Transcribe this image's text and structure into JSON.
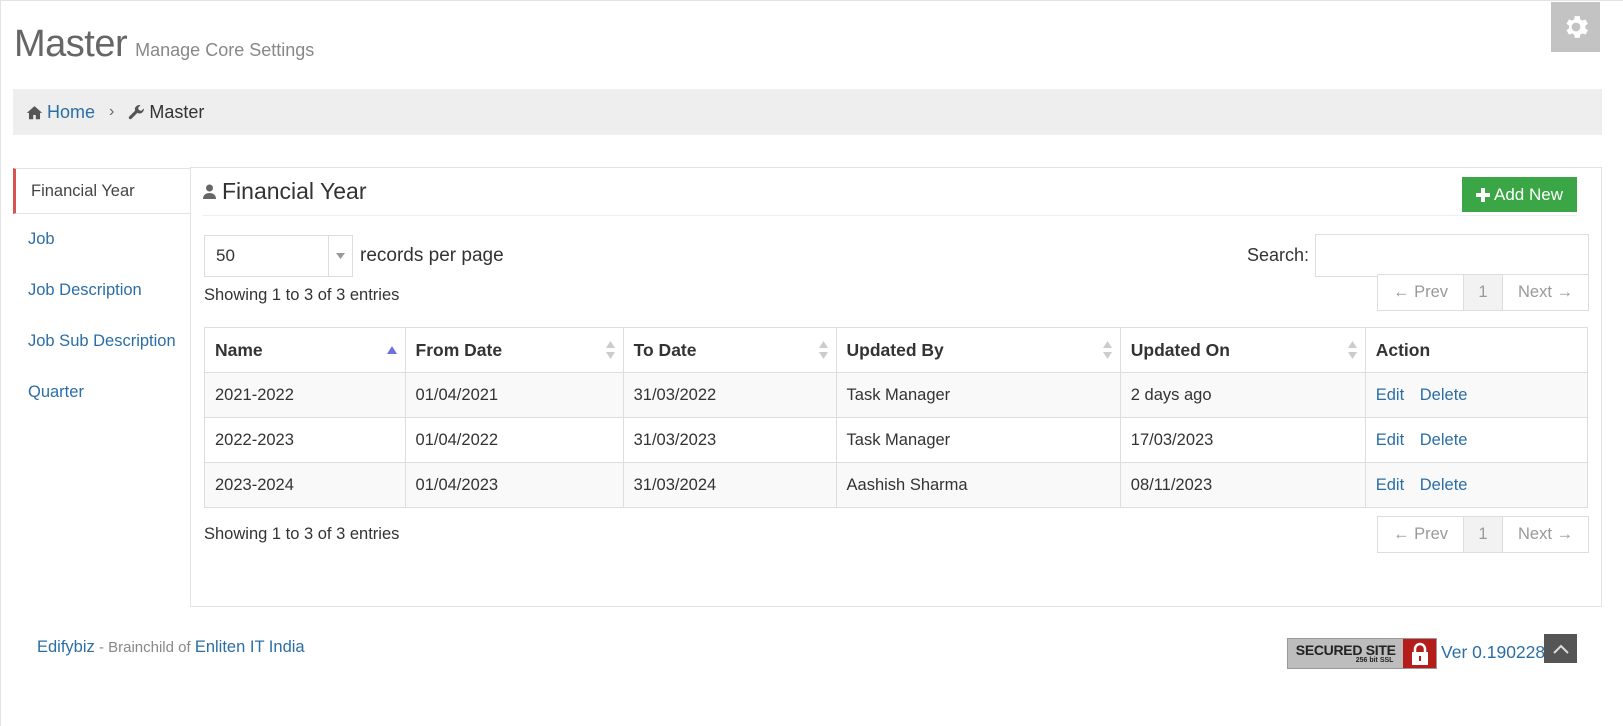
{
  "header": {
    "title": "Master",
    "subtitle": "Manage Core Settings"
  },
  "breadcrumb": [
    {
      "label": "Home",
      "icon": "home-icon"
    },
    {
      "label": "Master",
      "icon": "wrench-icon"
    }
  ],
  "sidebar": {
    "items": [
      {
        "label": "Financial Year",
        "active": true
      },
      {
        "label": "Job"
      },
      {
        "label": "Job Description"
      },
      {
        "label": "Job Sub Description"
      },
      {
        "label": "Quarter"
      }
    ]
  },
  "panel": {
    "title": "Financial Year",
    "title_icon": "user-icon",
    "add_button": "Add New"
  },
  "table_controls": {
    "page_length": "50",
    "page_length_label": "records per page",
    "search_label": "Search:",
    "search_value": "",
    "info": "Showing 1 to 3 of 3 entries",
    "pager": {
      "prev": "← Prev",
      "current": "1",
      "next": "Next →"
    }
  },
  "table": {
    "columns": [
      "Name",
      "From Date",
      "To Date",
      "Updated By",
      "Updated On",
      "Action"
    ],
    "rows": [
      {
        "name": "2021-2022",
        "from": "01/04/2021",
        "to": "31/03/2022",
        "updated_by": "Task Manager",
        "updated_on": "2 days ago",
        "edit": "Edit",
        "delete": "Delete"
      },
      {
        "name": "2022-2023",
        "from": "01/04/2022",
        "to": "31/03/2023",
        "updated_by": "Task Manager",
        "updated_on": "17/03/2023",
        "edit": "Edit",
        "delete": "Delete"
      },
      {
        "name": "2023-2024",
        "from": "01/04/2023",
        "to": "31/03/2024",
        "updated_by": "Aashish Sharma",
        "updated_on": "08/11/2023",
        "edit": "Edit",
        "delete": "Delete"
      }
    ]
  },
  "footer": {
    "brand": "Edifybiz",
    "separator": " - Brainchild of ",
    "company": "Enliten IT India",
    "ssl_main": "SECURED SITE",
    "ssl_sub": "256 bit SSL",
    "version": "Ver 0.190228"
  },
  "colors": {
    "accent_green": "#3aa646",
    "link_blue": "#2b6ea5",
    "active_border": "#d9534f",
    "ssl_red": "#b51c1c"
  }
}
